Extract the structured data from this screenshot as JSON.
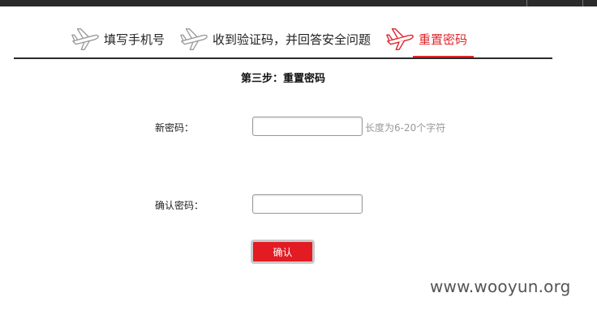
{
  "steps": [
    {
      "label": "填写手机号",
      "icon": "airplane-icon",
      "active": false
    },
    {
      "label": "收到验证码，并回答安全问题",
      "icon": "airplane-icon",
      "active": false
    },
    {
      "label": "重置密码",
      "icon": "airplane-icon",
      "active": true
    }
  ],
  "page_title": "第三步：重置密码",
  "form": {
    "new_password_label": "新密码：",
    "new_password_value": "",
    "new_password_hint": "长度为6-20个字符",
    "confirm_password_label": "确认密码：",
    "confirm_password_value": "",
    "submit_label": "确认"
  },
  "watermark": "www.wooyun.org",
  "colors": {
    "accent": "#e0262c",
    "button": "#e31b23",
    "topbar": "#2b2b2b",
    "inactive_icon": "#999999"
  }
}
